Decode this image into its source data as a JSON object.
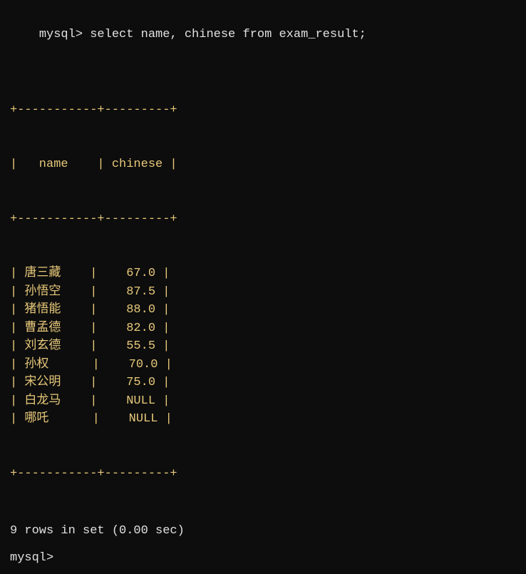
{
  "terminal": {
    "command": "mysql> select name, chinese from exam_result;",
    "separator_top": "+-----------+---------+",
    "header": "|   name    | chinese |",
    "separator_mid": "+-----------+---------+",
    "rows": [
      "| 唐三藏    |    67.0 |",
      "| 孙悟空    |    87.5 |",
      "| 猪悟能    |    88.0 |",
      "| 曹孟德    |    82.0 |",
      "| 刘玄德    |    55.5 |",
      "| 孙权      |    70.0 |",
      "| 宋公明    |    75.0 |",
      "| 白龙马    |    NULL |",
      "| 哪吒      |    NULL |"
    ],
    "separator_bottom": "+-----------+---------+",
    "result_info": "9 rows in set (0.00 sec)",
    "prompt": "mysql> "
  }
}
